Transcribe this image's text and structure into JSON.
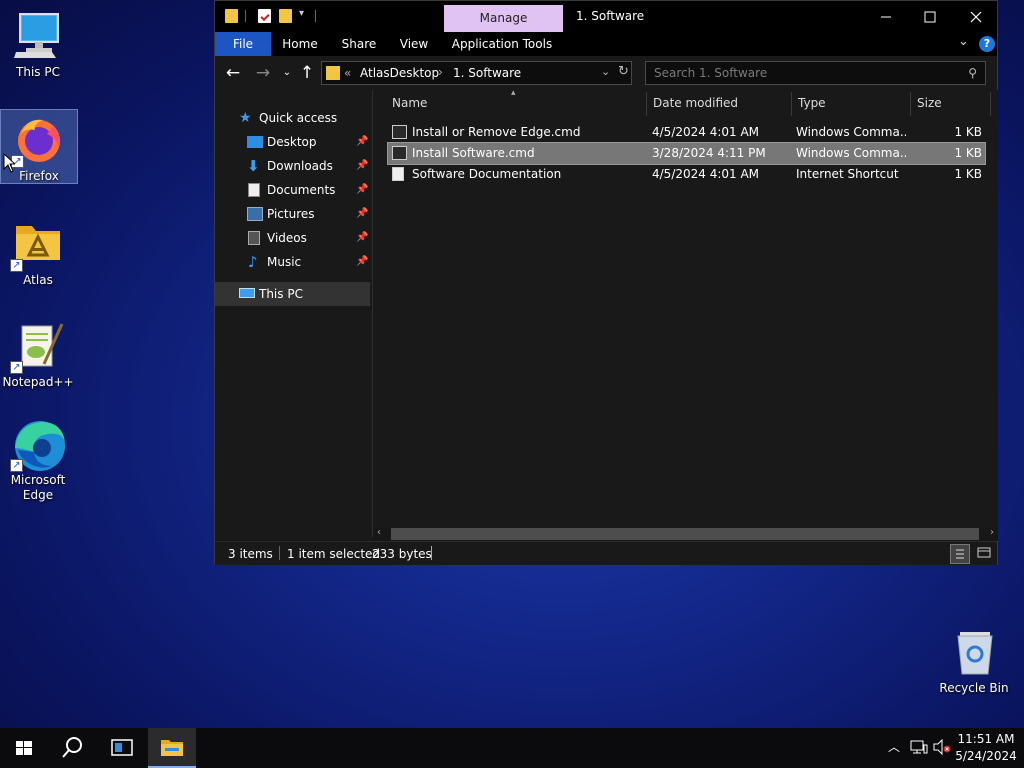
{
  "desktop": {
    "icons": [
      {
        "label": "This PC",
        "icon": "this-pc-icon"
      },
      {
        "label": "Firefox",
        "icon": "firefox-icon"
      },
      {
        "label": "Atlas",
        "icon": "atlas-folder-icon"
      },
      {
        "label": "Notepad++",
        "icon": "notepad-plus-plus-icon"
      },
      {
        "label": "Microsoft Edge",
        "icon": "edge-icon"
      },
      {
        "label": "Recycle Bin",
        "icon": "recycle-bin-icon"
      }
    ]
  },
  "window": {
    "title": "1. Software",
    "context_tab": "Manage",
    "ribbon_tabs": [
      "File",
      "Home",
      "Share",
      "View",
      "Application Tools"
    ],
    "address": {
      "overflow": "«",
      "parent": "AtlasDesktop",
      "current": "1. Software"
    },
    "search_placeholder": "Search 1. Software",
    "nav": {
      "quick_access": "Quick access",
      "items": [
        {
          "label": "Desktop",
          "icon": "desktop-folder-icon"
        },
        {
          "label": "Downloads",
          "icon": "downloads-icon"
        },
        {
          "label": "Documents",
          "icon": "documents-icon"
        },
        {
          "label": "Pictures",
          "icon": "pictures-icon"
        },
        {
          "label": "Videos",
          "icon": "videos-icon"
        },
        {
          "label": "Music",
          "icon": "music-icon"
        }
      ],
      "this_pc": "This PC"
    },
    "columns": {
      "name": "Name",
      "date": "Date modified",
      "type": "Type",
      "size": "Size"
    },
    "files": [
      {
        "name": "Install or Remove Edge.cmd",
        "date": "4/5/2024 4:01 AM",
        "type": "Windows Comma...",
        "size": "1 KB",
        "selected": false
      },
      {
        "name": "Install Software.cmd",
        "date": "3/28/2024 4:11 PM",
        "type": "Windows Comma...",
        "size": "1 KB",
        "selected": true
      },
      {
        "name": "Software Documentation",
        "date": "4/5/2024 4:01 AM",
        "type": "Internet Shortcut",
        "size": "1 KB",
        "selected": false
      }
    ],
    "status": {
      "items": "3 items",
      "selected": "1 item selected",
      "bytes": "233 bytes"
    }
  },
  "taskbar": {
    "time": "11:51 AM",
    "date": "5/24/2024"
  },
  "colors": {
    "accent": "#1b56c2",
    "manage_tab": "#e0c3f2",
    "selection": "#777777"
  }
}
